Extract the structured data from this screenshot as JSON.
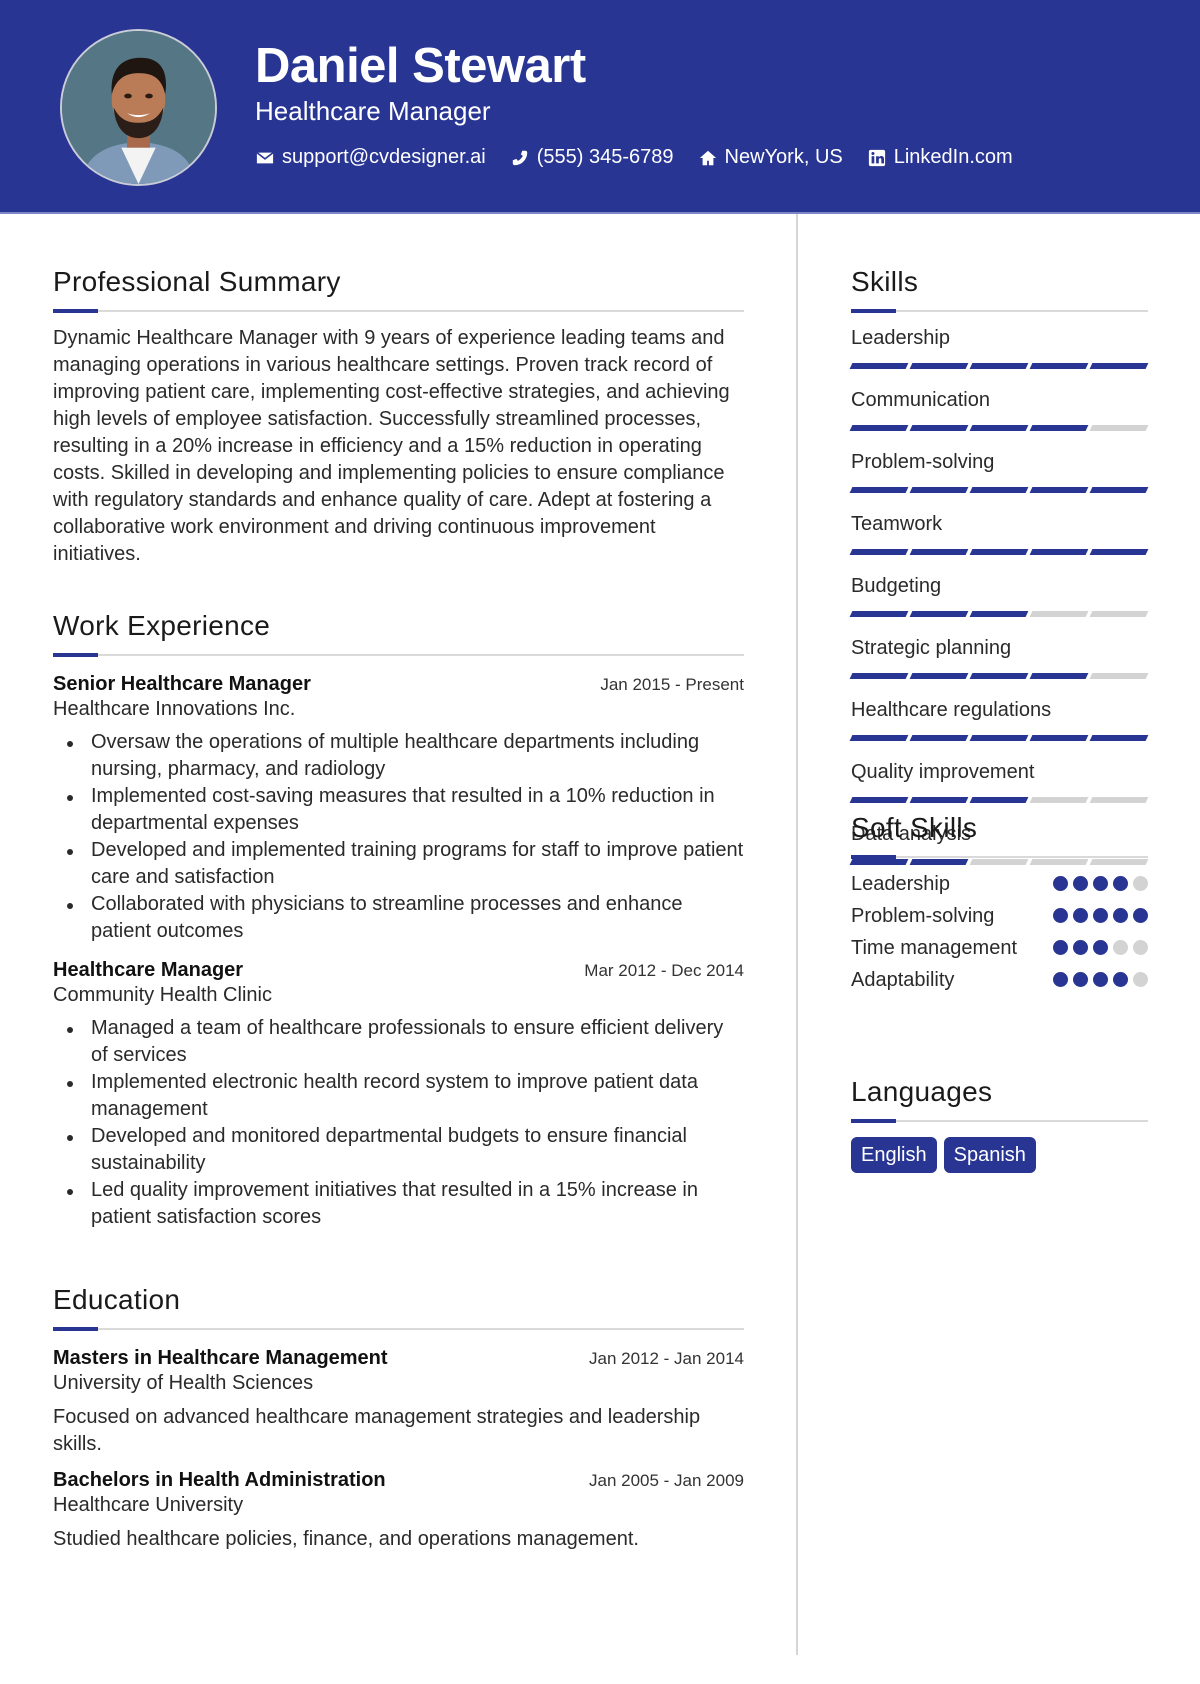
{
  "header": {
    "name": "Daniel Stewart",
    "role": "Healthcare Manager",
    "contacts": [
      {
        "icon": "envelope-icon",
        "text": "support@cvdesigner.ai"
      },
      {
        "icon": "phone-icon",
        "text": "(555) 345-6789"
      },
      {
        "icon": "home-icon",
        "text": "NewYork, US"
      },
      {
        "icon": "linkedin-icon",
        "text": "LinkedIn.com"
      }
    ]
  },
  "colors": {
    "accent": "#283593",
    "rule": "#d9d9d9",
    "inactive": "#d3d3d3"
  },
  "summary": {
    "title": "Professional Summary",
    "text": "Dynamic Healthcare Manager with 9 years of experience leading teams and managing operations in various healthcare settings. Proven track record of improving patient care, implementing cost-effective strategies, and achieving high levels of employee satisfaction. Successfully streamlined processes, resulting in a 20% increase in efficiency and a 15% reduction in operating costs. Skilled in developing and implementing policies to ensure compliance with regulatory standards and enhance quality of care. Adept at fostering a collaborative work environment and driving continuous improvement initiatives."
  },
  "experience": {
    "title": "Work Experience",
    "jobs": [
      {
        "title": "Senior Healthcare Manager",
        "company": "Healthcare Innovations Inc.",
        "dates": "Jan 2015 - Present",
        "bullets": [
          "Oversaw the operations of multiple healthcare departments including nursing, pharmacy, and radiology",
          "Implemented cost-saving measures that resulted in a 10% reduction in departmental expenses",
          "Developed and implemented training programs for staff to improve patient care and satisfaction",
          "Collaborated with physicians to streamline processes and enhance patient outcomes"
        ]
      },
      {
        "title": "Healthcare Manager",
        "company": "Community Health Clinic",
        "dates": "Mar 2012 - Dec 2014",
        "bullets": [
          "Managed a team of healthcare professionals to ensure efficient delivery of services",
          "Implemented electronic health record system to improve patient data management",
          "Developed and monitored departmental budgets to ensure financial sustainability",
          "Led quality improvement initiatives that resulted in a 15% increase in patient satisfaction scores"
        ]
      }
    ]
  },
  "education": {
    "title": "Education",
    "items": [
      {
        "degree": "Masters in Healthcare Management",
        "school": "University of Health Sciences",
        "dates": "Jan 2012 - Jan 2014",
        "description": "Focused on advanced healthcare management strategies and leadership skills."
      },
      {
        "degree": "Bachelors in Health Administration",
        "school": "Healthcare University",
        "dates": "Jan 2005 - Jan 2009",
        "description": "Studied healthcare policies, finance, and operations management."
      }
    ]
  },
  "skills": {
    "title": "Skills",
    "max": 5,
    "items": [
      {
        "label": "Leadership",
        "level": 5
      },
      {
        "label": "Communication",
        "level": 4
      },
      {
        "label": "Problem-solving",
        "level": 5
      },
      {
        "label": "Teamwork",
        "level": 5
      },
      {
        "label": "Budgeting",
        "level": 3
      },
      {
        "label": "Strategic planning",
        "level": 4
      },
      {
        "label": "Healthcare regulations",
        "level": 5
      },
      {
        "label": "Quality improvement",
        "level": 3
      },
      {
        "label": "Data analysis",
        "level": 2
      }
    ]
  },
  "soft_skills": {
    "title": "Soft Skills",
    "max": 5,
    "items": [
      {
        "label": "Leadership",
        "level": 4
      },
      {
        "label": "Problem-solving",
        "level": 5
      },
      {
        "label": "Time management",
        "level": 3
      },
      {
        "label": "Adaptability",
        "level": 4
      }
    ]
  },
  "languages": {
    "title": "Languages",
    "items": [
      "English",
      "Spanish"
    ]
  }
}
